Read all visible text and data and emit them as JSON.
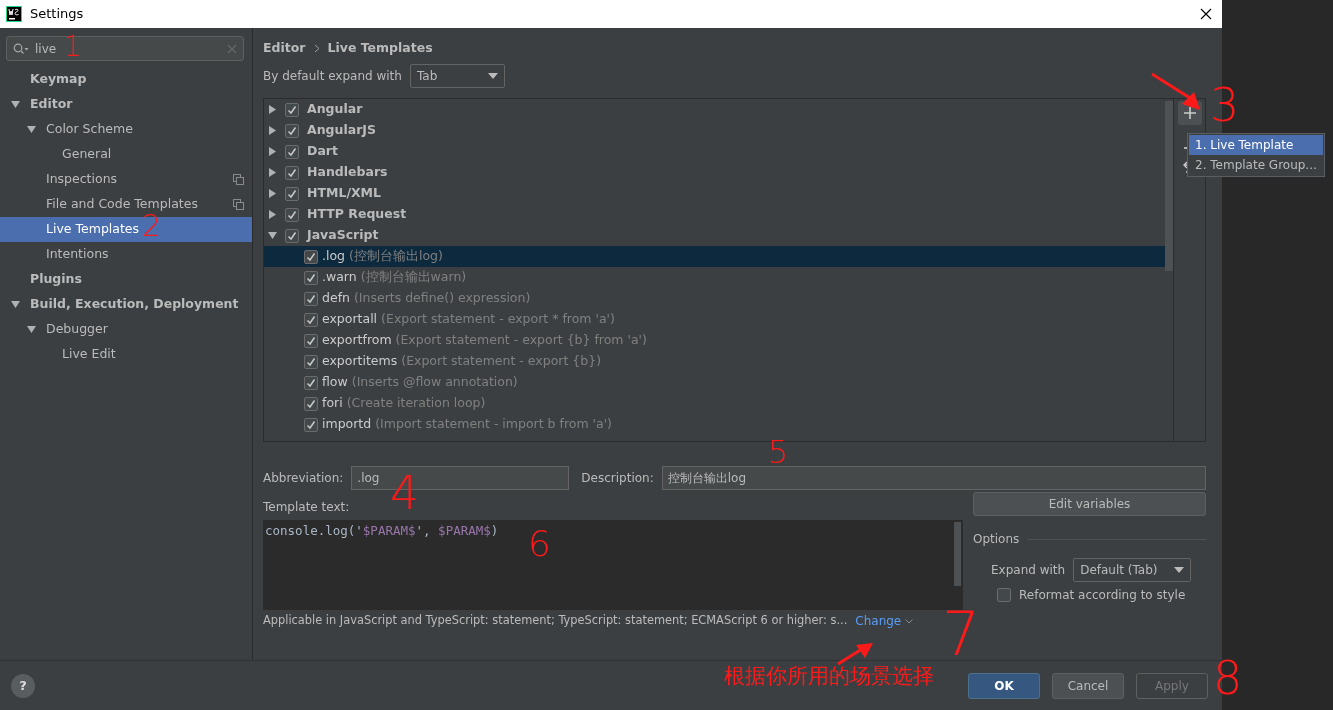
{
  "window": {
    "title": "Settings"
  },
  "search": {
    "value": "live"
  },
  "sidebar": {
    "items": [
      {
        "label": "Keymap",
        "selected": false
      },
      {
        "label": "Editor",
        "expanded": true,
        "selected": false,
        "children": [
          {
            "label": "Color Scheme",
            "expanded": true,
            "selected": false,
            "children": [
              {
                "label": "General",
                "selected": false
              }
            ]
          },
          {
            "label": "Inspections",
            "selected": false,
            "project_level": true
          },
          {
            "label": "File and Code Templates",
            "selected": false,
            "project_level": true
          },
          {
            "label": "Live Templates",
            "selected": true
          },
          {
            "label": "Intentions",
            "selected": false
          }
        ]
      },
      {
        "label": "Plugins",
        "selected": false
      },
      {
        "label": "Build, Execution, Deployment",
        "expanded": true,
        "selected": false,
        "children": [
          {
            "label": "Debugger",
            "expanded": true,
            "selected": false,
            "children": [
              {
                "label": "Live Edit",
                "selected": false
              }
            ]
          }
        ]
      }
    ]
  },
  "breadcrumb": [
    "Editor",
    "Live Templates"
  ],
  "expand_default": {
    "label": "By default expand with",
    "value": "Tab"
  },
  "template_groups": [
    {
      "name": "Angular",
      "checked": true,
      "expanded": false
    },
    {
      "name": "AngularJS",
      "checked": true,
      "expanded": false
    },
    {
      "name": "Dart",
      "checked": true,
      "expanded": false
    },
    {
      "name": "Handlebars",
      "checked": true,
      "expanded": false
    },
    {
      "name": "HTML/XML",
      "checked": true,
      "expanded": false
    },
    {
      "name": "HTTP Request",
      "checked": true,
      "expanded": false
    },
    {
      "name": "JavaScript",
      "checked": true,
      "expanded": true,
      "templates": [
        {
          "abbreviation": ".log",
          "description": "(控制台输出log)",
          "checked": true,
          "selected": true
        },
        {
          "abbreviation": ".warn",
          "description": "(控制台输出warn)",
          "checked": true,
          "selected": false
        },
        {
          "abbreviation": "defn",
          "description": "(Inserts define() expression)",
          "checked": true,
          "selected": false
        },
        {
          "abbreviation": "exportall",
          "description": "(Export statement - export * from 'a')",
          "checked": true,
          "selected": false
        },
        {
          "abbreviation": "exportfrom",
          "description": "(Export statement - export {b} from 'a')",
          "checked": true,
          "selected": false
        },
        {
          "abbreviation": "exportitems",
          "description": "(Export statement - export {b})",
          "checked": true,
          "selected": false
        },
        {
          "abbreviation": "flow",
          "description": "(Inserts @flow annotation)",
          "checked": true,
          "selected": false
        },
        {
          "abbreviation": "fori",
          "description": "(Create iteration loop)",
          "checked": true,
          "selected": false
        },
        {
          "abbreviation": "importd",
          "description": "(Import statement - import b from 'a')",
          "checked": true,
          "selected": false
        }
      ]
    }
  ],
  "add_menu": {
    "items": [
      {
        "label": "1. Live Template",
        "selected": true
      },
      {
        "label": "2. Template Group...",
        "selected": false
      }
    ]
  },
  "abbreviation": {
    "label": "Abbreviation:",
    "value": ".log"
  },
  "description": {
    "label": "Description:",
    "value": "控制台输出log"
  },
  "template_text": {
    "label": "Template text:",
    "segments": [
      {
        "text": "console.log('",
        "kind": "plain"
      },
      {
        "text": "$PARAM$",
        "kind": "variable"
      },
      {
        "text": "', ",
        "kind": "plain"
      },
      {
        "text": "$PARAM$",
        "kind": "variable"
      },
      {
        "text": ")",
        "kind": "plain"
      }
    ]
  },
  "edit_variables": "Edit variables",
  "options": {
    "title": "Options",
    "expand_label": "Expand with",
    "expand_value": "Default (Tab)",
    "reformat": {
      "label": "Reformat according to style",
      "checked": false
    }
  },
  "applicable": {
    "text": "Applicable in JavaScript and TypeScript: statement; TypeScript: statement; ECMAScript 6 or higher: s...",
    "link": "Change"
  },
  "footer": {
    "help": "?",
    "buttons": [
      {
        "label": "OK",
        "kind": "primary"
      },
      {
        "label": "Cancel",
        "kind": "normal"
      },
      {
        "label": "Apply",
        "kind": "disabled"
      }
    ]
  },
  "annotations": [
    {
      "kind": "number",
      "text": "1"
    },
    {
      "kind": "number",
      "text": "2"
    },
    {
      "kind": "arrow"
    },
    {
      "kind": "number",
      "text": "3"
    },
    {
      "kind": "number",
      "text": "4"
    },
    {
      "kind": "number",
      "text": "5"
    },
    {
      "kind": "number",
      "text": "6"
    },
    {
      "kind": "arrow"
    },
    {
      "kind": "number",
      "text": "7"
    },
    {
      "kind": "note",
      "text": "根据你所用的场景选择"
    },
    {
      "kind": "number",
      "text": "8"
    }
  ]
}
